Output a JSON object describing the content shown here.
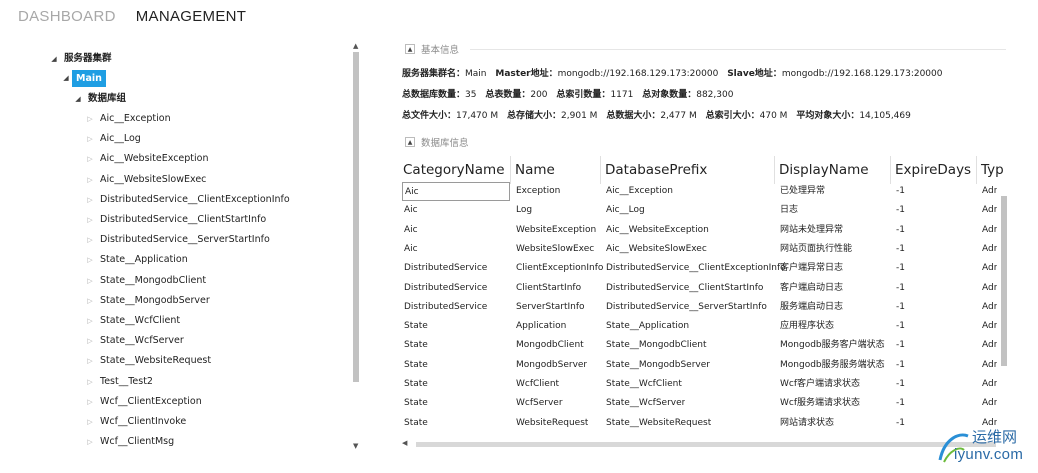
{
  "nav": {
    "dashboard": "DASHBOARD",
    "management": "MANAGEMENT"
  },
  "tree": {
    "root": "服务器集群",
    "main": "Main",
    "group": "数据库组",
    "items": [
      "Aic__Exception",
      "Aic__Log",
      "Aic__WebsiteException",
      "Aic__WebsiteSlowExec",
      "DistributedService__ClientExceptionInfo",
      "DistributedService__ClientStartInfo",
      "DistributedService__ServerStartInfo",
      "State__Application",
      "State__MongodbClient",
      "State__MongodbServer",
      "State__WcfClient",
      "State__WcfServer",
      "State__WebsiteRequest",
      "Test__Test2",
      "Wcf__ClientException",
      "Wcf__ClientInvoke",
      "Wcf__ClientMsg"
    ]
  },
  "basic": {
    "title": "基本信息",
    "cluster_label": "服务器集群名：",
    "cluster_value": "Main",
    "master_label": "Master地址：",
    "master_value": "mongodb://192.168.129.173:20000",
    "slave_label": "Slave地址：",
    "slave_value": "mongodb://192.168.129.173:20000",
    "db_count_label": "总数据库数量：",
    "db_count": "35",
    "table_count_label": "总表数量：",
    "table_count": "200",
    "index_count_label": "总索引数量：",
    "index_count": "1171",
    "object_count_label": "总对象数量：",
    "object_count": "882,300",
    "file_size_label": "总文件大小：",
    "file_size": "17,470 M",
    "storage_size_label": "总存储大小：",
    "storage_size": "2,901 M",
    "data_size_label": "总数据大小：",
    "data_size": "2,477 M",
    "index_size_label": "总索引大小：",
    "index_size": "470 M",
    "avg_obj_label": "平均对象大小：",
    "avg_obj": "14,105,469"
  },
  "dbinfo": {
    "title": "数据库信息",
    "columns": [
      "CategoryName",
      "Name",
      "DatabasePrefix",
      "DisplayName",
      "ExpireDays",
      "Typ"
    ],
    "rows": [
      [
        "Aic",
        "Exception",
        "Aic__Exception",
        "已处理异常",
        "-1",
        "Adr"
      ],
      [
        "Aic",
        "Log",
        "Aic__Log",
        "日志",
        "-1",
        "Adr"
      ],
      [
        "Aic",
        "WebsiteException",
        "Aic__WebsiteException",
        "网站未处理异常",
        "-1",
        "Adr"
      ],
      [
        "Aic",
        "WebsiteSlowExec",
        "Aic__WebsiteSlowExec",
        "网站页面执行性能",
        "-1",
        "Adr"
      ],
      [
        "DistributedService",
        "ClientExceptionInfo",
        "DistributedService__ClientExceptionInfo",
        "客户端异常日志",
        "-1",
        "Adr"
      ],
      [
        "DistributedService",
        "ClientStartInfo",
        "DistributedService__ClientStartInfo",
        "客户端启动日志",
        "-1",
        "Adr"
      ],
      [
        "DistributedService",
        "ServerStartInfo",
        "DistributedService__ServerStartInfo",
        "服务端启动日志",
        "-1",
        "Adr"
      ],
      [
        "State",
        "Application",
        "State__Application",
        "应用程序状态",
        "-1",
        "Adr"
      ],
      [
        "State",
        "MongodbClient",
        "State__MongodbClient",
        "Mongodb服务客户端状态",
        "-1",
        "Adr"
      ],
      [
        "State",
        "MongodbServer",
        "State__MongodbServer",
        "Mongodb服务服务端状态",
        "-1",
        "Adr"
      ],
      [
        "State",
        "WcfClient",
        "State__WcfClient",
        "Wcf客户端请求状态",
        "-1",
        "Adr"
      ],
      [
        "State",
        "WcfServer",
        "State__WcfServer",
        "Wcf服务端请求状态",
        "-1",
        "Adr"
      ],
      [
        "State",
        "WebsiteRequest",
        "State__WebsiteRequest",
        "网站请求状态",
        "-1",
        "Adr"
      ]
    ]
  },
  "watermark": {
    "line1": "运维网",
    "line2": "iyunv.com"
  }
}
